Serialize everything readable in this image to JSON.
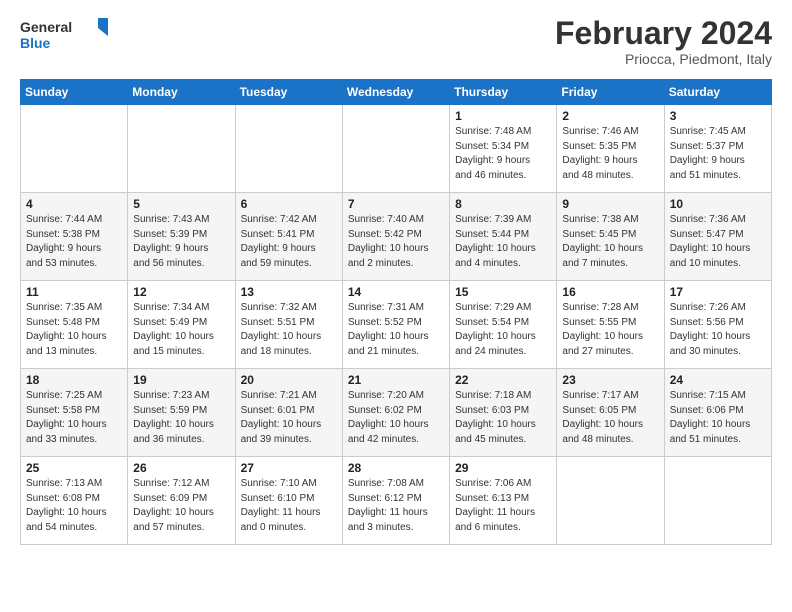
{
  "header": {
    "logo_line1": "General",
    "logo_line2": "Blue",
    "month": "February 2024",
    "location": "Priocca, Piedmont, Italy"
  },
  "days_of_week": [
    "Sunday",
    "Monday",
    "Tuesday",
    "Wednesday",
    "Thursday",
    "Friday",
    "Saturday"
  ],
  "weeks": [
    [
      {
        "day": "",
        "info": ""
      },
      {
        "day": "",
        "info": ""
      },
      {
        "day": "",
        "info": ""
      },
      {
        "day": "",
        "info": ""
      },
      {
        "day": "1",
        "info": "Sunrise: 7:48 AM\nSunset: 5:34 PM\nDaylight: 9 hours\nand 46 minutes."
      },
      {
        "day": "2",
        "info": "Sunrise: 7:46 AM\nSunset: 5:35 PM\nDaylight: 9 hours\nand 48 minutes."
      },
      {
        "day": "3",
        "info": "Sunrise: 7:45 AM\nSunset: 5:37 PM\nDaylight: 9 hours\nand 51 minutes."
      }
    ],
    [
      {
        "day": "4",
        "info": "Sunrise: 7:44 AM\nSunset: 5:38 PM\nDaylight: 9 hours\nand 53 minutes."
      },
      {
        "day": "5",
        "info": "Sunrise: 7:43 AM\nSunset: 5:39 PM\nDaylight: 9 hours\nand 56 minutes."
      },
      {
        "day": "6",
        "info": "Sunrise: 7:42 AM\nSunset: 5:41 PM\nDaylight: 9 hours\nand 59 minutes."
      },
      {
        "day": "7",
        "info": "Sunrise: 7:40 AM\nSunset: 5:42 PM\nDaylight: 10 hours\nand 2 minutes."
      },
      {
        "day": "8",
        "info": "Sunrise: 7:39 AM\nSunset: 5:44 PM\nDaylight: 10 hours\nand 4 minutes."
      },
      {
        "day": "9",
        "info": "Sunrise: 7:38 AM\nSunset: 5:45 PM\nDaylight: 10 hours\nand 7 minutes."
      },
      {
        "day": "10",
        "info": "Sunrise: 7:36 AM\nSunset: 5:47 PM\nDaylight: 10 hours\nand 10 minutes."
      }
    ],
    [
      {
        "day": "11",
        "info": "Sunrise: 7:35 AM\nSunset: 5:48 PM\nDaylight: 10 hours\nand 13 minutes."
      },
      {
        "day": "12",
        "info": "Sunrise: 7:34 AM\nSunset: 5:49 PM\nDaylight: 10 hours\nand 15 minutes."
      },
      {
        "day": "13",
        "info": "Sunrise: 7:32 AM\nSunset: 5:51 PM\nDaylight: 10 hours\nand 18 minutes."
      },
      {
        "day": "14",
        "info": "Sunrise: 7:31 AM\nSunset: 5:52 PM\nDaylight: 10 hours\nand 21 minutes."
      },
      {
        "day": "15",
        "info": "Sunrise: 7:29 AM\nSunset: 5:54 PM\nDaylight: 10 hours\nand 24 minutes."
      },
      {
        "day": "16",
        "info": "Sunrise: 7:28 AM\nSunset: 5:55 PM\nDaylight: 10 hours\nand 27 minutes."
      },
      {
        "day": "17",
        "info": "Sunrise: 7:26 AM\nSunset: 5:56 PM\nDaylight: 10 hours\nand 30 minutes."
      }
    ],
    [
      {
        "day": "18",
        "info": "Sunrise: 7:25 AM\nSunset: 5:58 PM\nDaylight: 10 hours\nand 33 minutes."
      },
      {
        "day": "19",
        "info": "Sunrise: 7:23 AM\nSunset: 5:59 PM\nDaylight: 10 hours\nand 36 minutes."
      },
      {
        "day": "20",
        "info": "Sunrise: 7:21 AM\nSunset: 6:01 PM\nDaylight: 10 hours\nand 39 minutes."
      },
      {
        "day": "21",
        "info": "Sunrise: 7:20 AM\nSunset: 6:02 PM\nDaylight: 10 hours\nand 42 minutes."
      },
      {
        "day": "22",
        "info": "Sunrise: 7:18 AM\nSunset: 6:03 PM\nDaylight: 10 hours\nand 45 minutes."
      },
      {
        "day": "23",
        "info": "Sunrise: 7:17 AM\nSunset: 6:05 PM\nDaylight: 10 hours\nand 48 minutes."
      },
      {
        "day": "24",
        "info": "Sunrise: 7:15 AM\nSunset: 6:06 PM\nDaylight: 10 hours\nand 51 minutes."
      }
    ],
    [
      {
        "day": "25",
        "info": "Sunrise: 7:13 AM\nSunset: 6:08 PM\nDaylight: 10 hours\nand 54 minutes."
      },
      {
        "day": "26",
        "info": "Sunrise: 7:12 AM\nSunset: 6:09 PM\nDaylight: 10 hours\nand 57 minutes."
      },
      {
        "day": "27",
        "info": "Sunrise: 7:10 AM\nSunset: 6:10 PM\nDaylight: 11 hours\nand 0 minutes."
      },
      {
        "day": "28",
        "info": "Sunrise: 7:08 AM\nSunset: 6:12 PM\nDaylight: 11 hours\nand 3 minutes."
      },
      {
        "day": "29",
        "info": "Sunrise: 7:06 AM\nSunset: 6:13 PM\nDaylight: 11 hours\nand 6 minutes."
      },
      {
        "day": "",
        "info": ""
      },
      {
        "day": "",
        "info": ""
      }
    ]
  ]
}
